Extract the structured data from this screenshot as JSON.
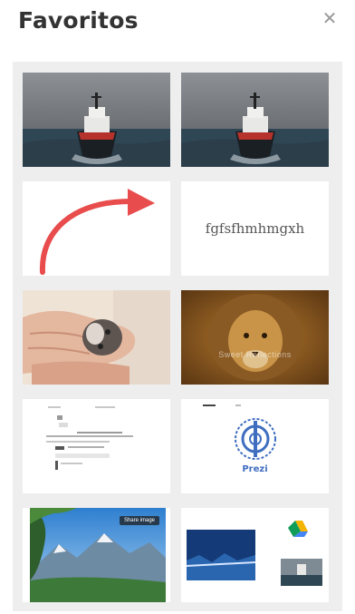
{
  "header": {
    "title": "Favoritos",
    "close_icon": "close-icon"
  },
  "favorites": {
    "items": [
      {
        "kind": "photo",
        "subject": "ship-at-sea"
      },
      {
        "kind": "photo",
        "subject": "ship-at-sea"
      },
      {
        "kind": "drawing",
        "subject": "red-curved-arrow"
      },
      {
        "kind": "text",
        "text": "fgfsfhmhmgxh"
      },
      {
        "kind": "photo",
        "subject": "hands-holding-kitten"
      },
      {
        "kind": "photo",
        "subject": "lion",
        "overlay_text": "Sweet Reflections"
      },
      {
        "kind": "document",
        "subject": "document-screenshot"
      },
      {
        "kind": "logo",
        "subject": "prezi-logo",
        "label": "Prezi"
      },
      {
        "kind": "photo",
        "subject": "mountain-lake",
        "overlay_text": "Share image"
      },
      {
        "kind": "collage",
        "subject": "drive-collage"
      }
    ]
  },
  "colors": {
    "title": "#333333",
    "grid_background": "#eeeeee",
    "card_background": "#ffffff",
    "accent_red": "#e84c4c",
    "prezi_blue": "#3f6ec0"
  }
}
